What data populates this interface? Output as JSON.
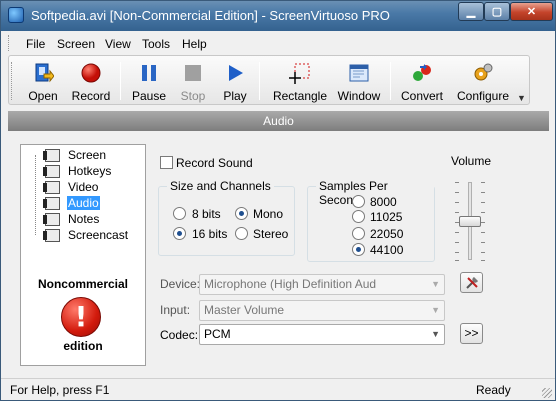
{
  "window": {
    "title": "Softpedia.avi [Non-Commercial Edition] - ScreenVirtuoso PRO"
  },
  "menu": [
    "File",
    "Screen",
    "View",
    "Tools",
    "Help"
  ],
  "toolbar": {
    "open": "Open",
    "record": "Record",
    "pause": "Pause",
    "stop": "Stop",
    "play": "Play",
    "rectangle": "Rectangle",
    "window": "Window",
    "convert": "Convert",
    "configure": "Configure"
  },
  "section_title": "Audio",
  "tree": [
    "Screen",
    "Hotkeys",
    "Video",
    "Audio",
    "Notes",
    "Screencast"
  ],
  "notice": {
    "top": "Noncommercial",
    "bottom": "edition",
    "icon": "!"
  },
  "record_sound": "Record Sound",
  "size_channels": {
    "title": "Size and Channels",
    "bits8": "8 bits",
    "bits16": "16 bits",
    "mono": "Mono",
    "stereo": "Stereo"
  },
  "samples": {
    "title": "Samples Per Second",
    "r1": "8000",
    "r2": "11025",
    "r3": "22050",
    "r4": "44100"
  },
  "volume_label": "Volume",
  "volume_level": 0.5,
  "device": {
    "label": "Device:",
    "value": "Microphone (High Definition Aud"
  },
  "input": {
    "label": "Input:",
    "value": "Master Volume"
  },
  "codec": {
    "label": "Codec:",
    "value": "PCM",
    "more": ">>"
  },
  "status": {
    "left": "For Help, press F1",
    "right": "Ready"
  },
  "colors": {
    "selection": "#3399ff",
    "record_red": "#e0201a",
    "play_blue": "#1f5fc8"
  }
}
